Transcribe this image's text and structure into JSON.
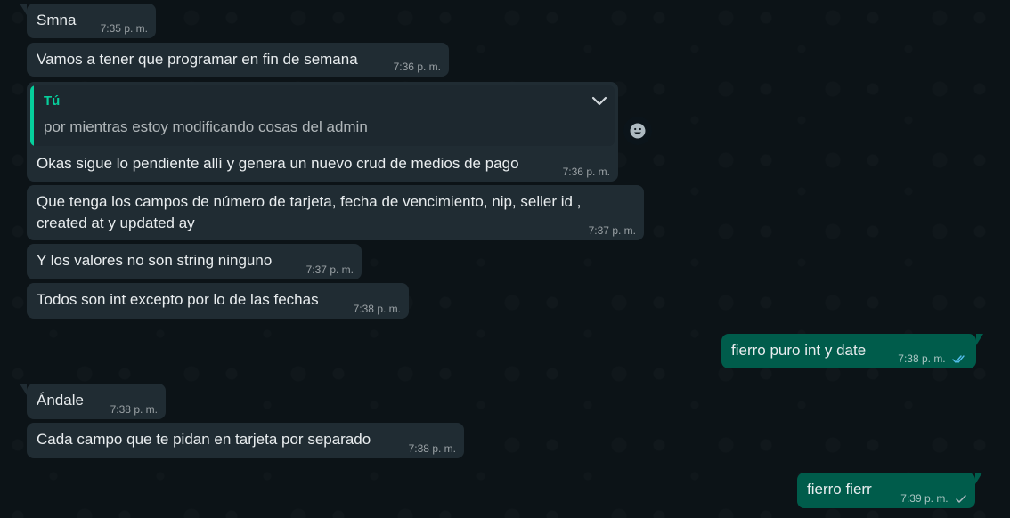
{
  "messages": [
    {
      "id": "m1",
      "direction": "incoming",
      "text": "Smna",
      "time": "7:35 p. m."
    },
    {
      "id": "m2",
      "direction": "incoming",
      "text": "Vamos a tener que programar en fin de semana",
      "time": "7:36 p. m."
    },
    {
      "id": "m3",
      "direction": "incoming",
      "quoted": {
        "author": "Tú",
        "text": "por mientras estoy modificando cosas del admin"
      },
      "text": "Okas sigue lo pendiente allí y genera un nuevo crud de medios de pago",
      "time": "7:36 p. m."
    },
    {
      "id": "m4",
      "direction": "incoming",
      "text": "Que tenga los campos de número de tarjeta, fecha de vencimiento, nip, seller id , created at y updated ay",
      "time": "7:37 p. m."
    },
    {
      "id": "m5",
      "direction": "incoming",
      "text": "Y los valores no son string ninguno",
      "time": "7:37 p. m."
    },
    {
      "id": "m6",
      "direction": "incoming",
      "text": "Todos son int excepto por lo de las fechas",
      "time": "7:38 p. m."
    },
    {
      "id": "m7",
      "direction": "outgoing",
      "text": "fierro puro int y date",
      "time": "7:38 p. m.",
      "status": "read"
    },
    {
      "id": "m8",
      "direction": "incoming",
      "text": "Ándale",
      "time": "7:38 p. m."
    },
    {
      "id": "m9",
      "direction": "incoming",
      "text": "Cada campo que te pidan en tarjeta por separado",
      "time": "7:38 p. m."
    },
    {
      "id": "m10",
      "direction": "outgoing",
      "text": "fierro fierr",
      "time": "7:39 p. m.",
      "status": "delivered"
    }
  ],
  "icons": {
    "message_menu": "chevron-down-icon",
    "reaction": "emoji-icon",
    "read_receipt": "double-check-icon",
    "delivered_receipt": "single-check-icon"
  },
  "colors": {
    "background": "#0b141a",
    "incoming_bubble": "#202c33",
    "outgoing_bubble": "#005c4b",
    "quote_accent": "#06cf9c",
    "read_tick": "#53bdeb"
  }
}
